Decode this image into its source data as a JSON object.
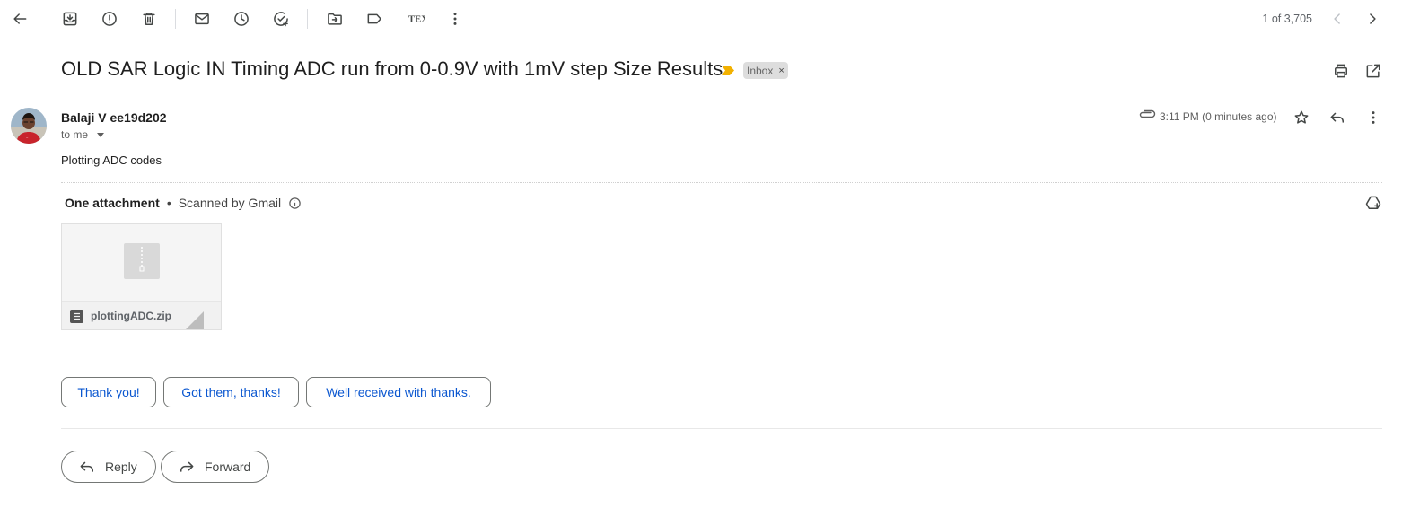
{
  "toolbar": {
    "icons": [
      "back-arrow-icon",
      "archive-icon",
      "report-spam-icon",
      "delete-icon",
      "mark-unread-icon",
      "snooze-icon",
      "add-to-tasks-icon",
      "move-to-icon",
      "labels-icon",
      "tex-icon",
      "more-vert-icon"
    ],
    "tex_label": "TEX"
  },
  "pager": {
    "text": "1 of 3,705"
  },
  "email": {
    "subject": "OLD SAR Logic IN Timing ADC run from 0-0.9V with 1mV step Size Results",
    "label": "Inbox",
    "label_remove": "×",
    "sender_name": "Balaji V ee19d202",
    "recipient": "to me",
    "time": "3:11 PM (0 minutes ago)",
    "body": "Plotting ADC codes"
  },
  "attachments": {
    "count_label": "One attachment",
    "separator": "•",
    "scanned_label": "Scanned by Gmail",
    "files": [
      {
        "name": "plottingADC.zip"
      }
    ]
  },
  "smart_replies": [
    "Thank you!",
    "Got them, thanks!",
    "Well received with thanks."
  ],
  "actions": {
    "reply": "Reply",
    "forward": "Forward"
  },
  "colors": {
    "accent_blue": "#0b57d0",
    "importance": "#f2b100",
    "label_bg": "#dddddd"
  }
}
